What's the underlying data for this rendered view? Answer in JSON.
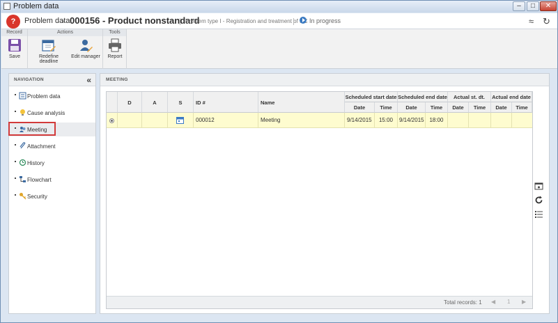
{
  "window": {
    "title": "Problem data",
    "minimize": "–",
    "maximize": "□",
    "close": "✕"
  },
  "header": {
    "logo": "?",
    "crumb_section": "Problem data",
    "crumb_separator": "›",
    "record_title": "000156 - Product nonstandard",
    "problem_type": "Problem type I - Registration and treatment of NC",
    "status": "In progress",
    "collapse_glyph": "≈",
    "refresh_glyph": "↻"
  },
  "ribbon": {
    "groups": [
      {
        "label": "Record"
      },
      {
        "label": "Actions"
      },
      {
        "label": "Tools"
      }
    ],
    "save_label": "Save",
    "redefine_label": "Redefine deadline",
    "edit_manager_label": "Edit manager",
    "report_label": "Report"
  },
  "navigation": {
    "title": "NAVIGATION",
    "collapse_glyph": "«",
    "items": [
      {
        "label": "Problem data",
        "icon": "document-icon"
      },
      {
        "label": "Cause analysis",
        "icon": "lightbulb-icon"
      },
      {
        "label": "Meeting",
        "icon": "people-icon"
      },
      {
        "label": "Attachment",
        "icon": "paperclip-icon"
      },
      {
        "label": "History",
        "icon": "history-icon"
      },
      {
        "label": "Flowchart",
        "icon": "flowchart-icon"
      },
      {
        "label": "Security",
        "icon": "key-icon"
      }
    ],
    "active_index": 2
  },
  "meeting_panel": {
    "title": "MEETING",
    "columns": {
      "d": "D",
      "a": "A",
      "s": "S",
      "id": "ID #",
      "name": "Name",
      "sched_start": "Scheduled start date",
      "sched_end": "Scheduled end date",
      "actual_start": "Actual st. dt.",
      "actual_end": "Actual end date",
      "date": "Date",
      "time": "Time"
    },
    "rows": [
      {
        "id": "000012",
        "name": "Meeting",
        "sched_start_date": "9/14/2015",
        "sched_start_time": "15:00",
        "sched_end_date": "9/14/2015",
        "sched_end_time": "18:00",
        "actual_start_date": "",
        "actual_start_time": "",
        "actual_end_date": "",
        "actual_end_time": "",
        "selected": true
      }
    ],
    "total_records": "Total records: 1",
    "pager": {
      "prev": "◀",
      "page": "1",
      "next": "▶"
    }
  }
}
